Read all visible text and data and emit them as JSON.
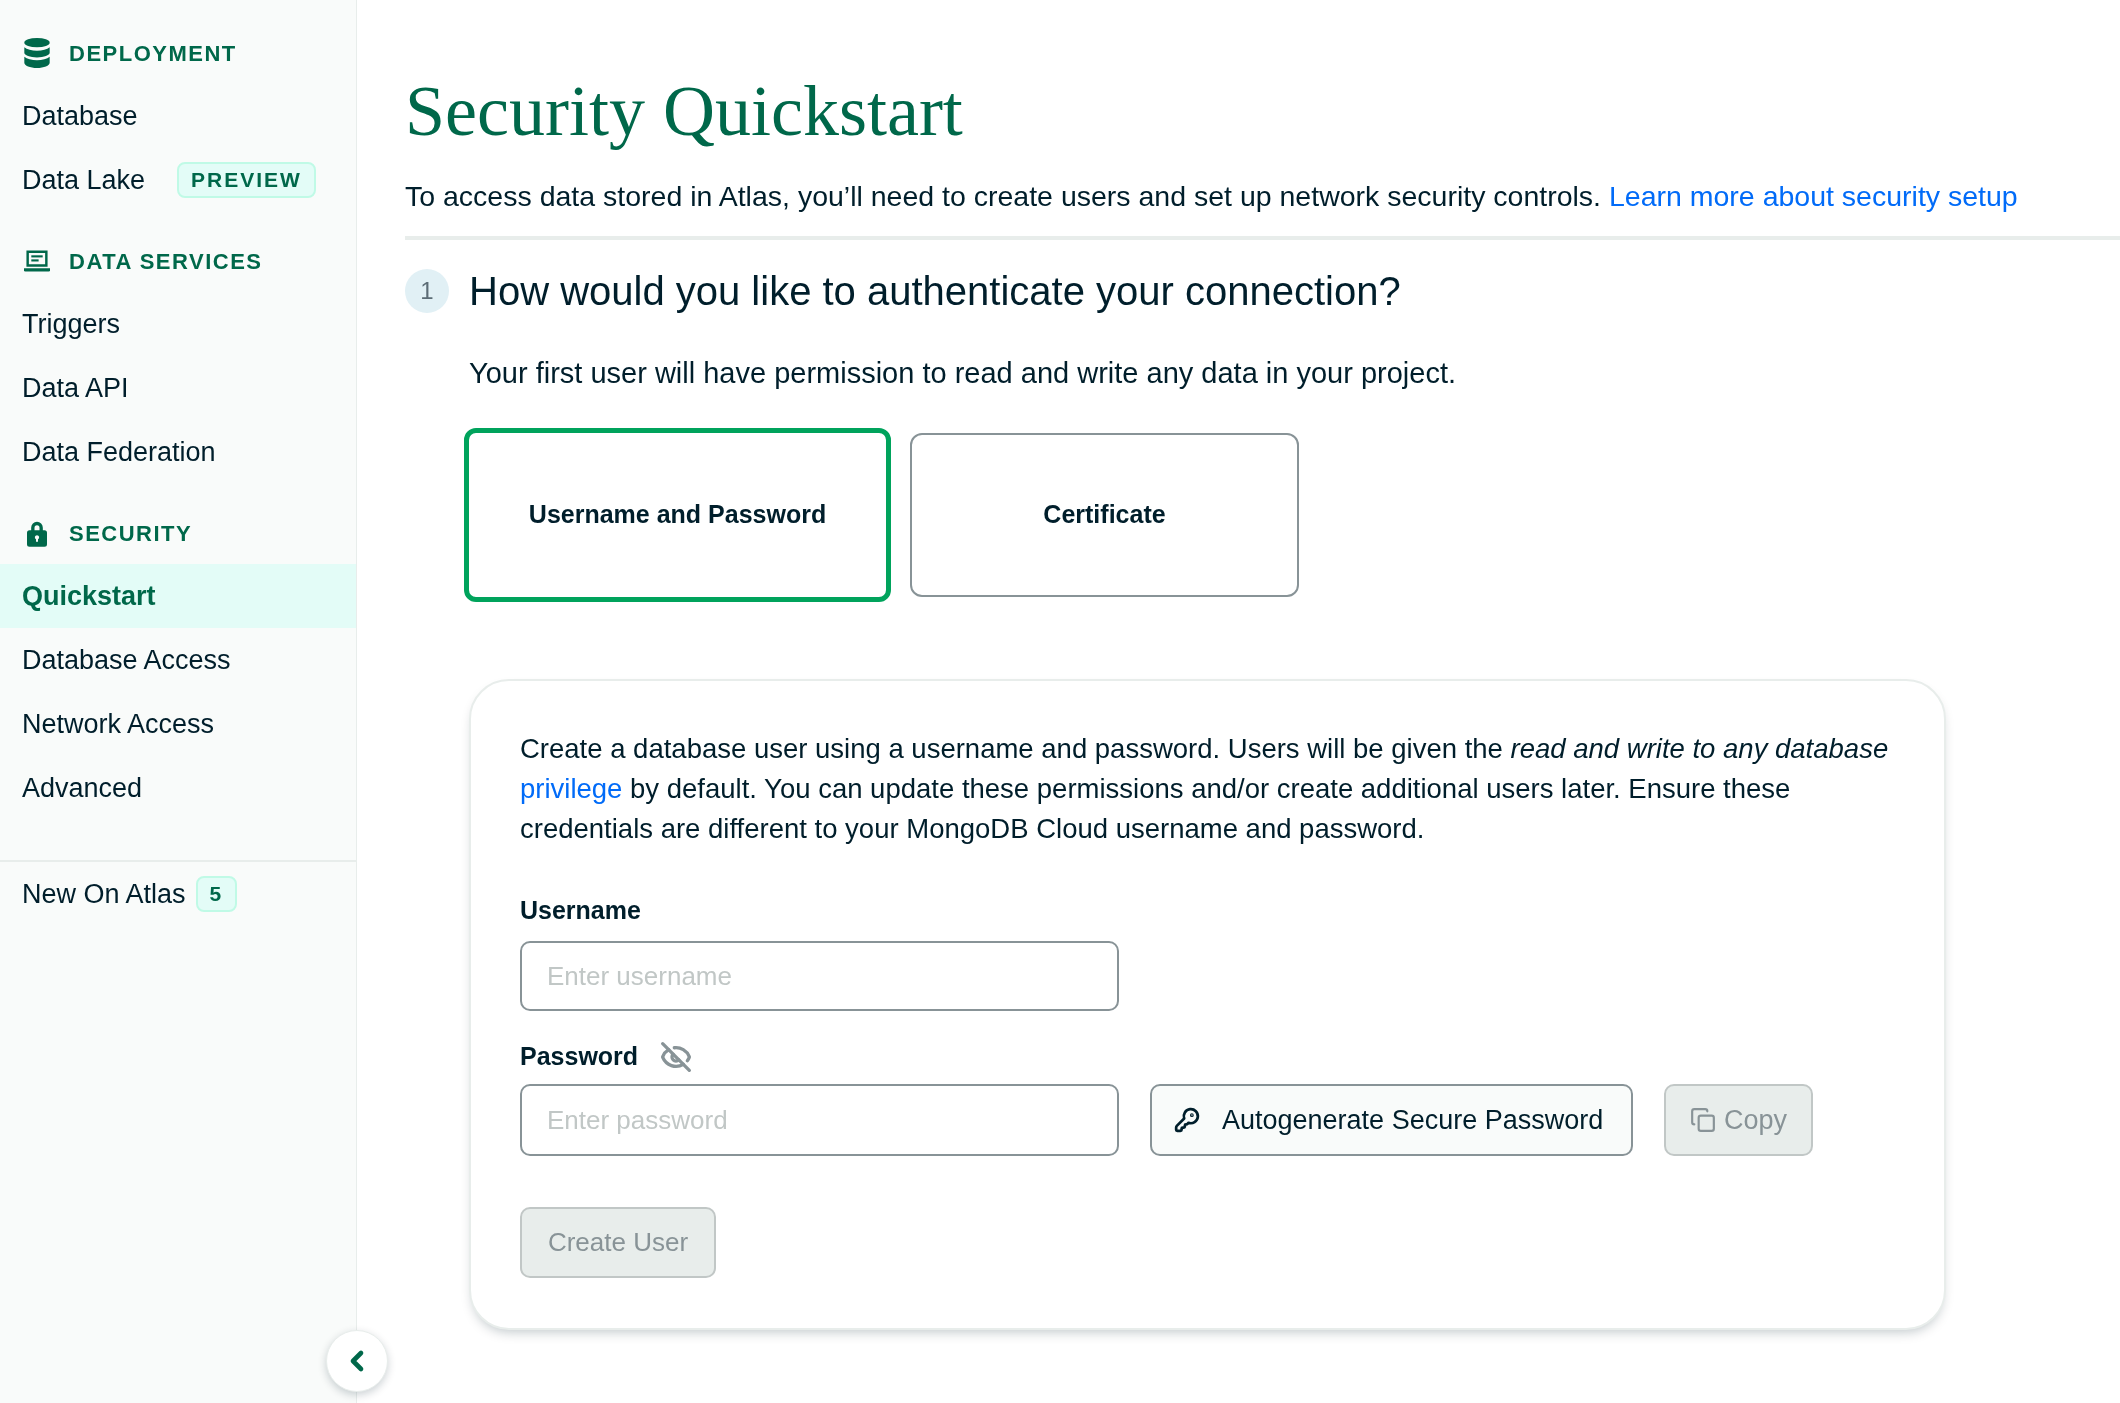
{
  "sidebar": {
    "sections": [
      {
        "title": "DEPLOYMENT",
        "items": [
          {
            "label": "Database",
            "selected": false
          },
          {
            "label": "Data Lake",
            "selected": false,
            "badge": "PREVIEW"
          }
        ]
      },
      {
        "title": "DATA SERVICES",
        "items": [
          {
            "label": "Triggers",
            "selected": false
          },
          {
            "label": "Data API",
            "selected": false
          },
          {
            "label": "Data Federation",
            "selected": false
          }
        ]
      },
      {
        "title": "SECURITY",
        "items": [
          {
            "label": "Quickstart",
            "selected": true
          },
          {
            "label": "Database Access",
            "selected": false
          },
          {
            "label": "Network Access",
            "selected": false
          },
          {
            "label": "Advanced",
            "selected": false
          }
        ]
      }
    ],
    "footer_items": [
      {
        "label": "New On Atlas",
        "selected": false,
        "badge": "5"
      }
    ]
  },
  "header": {
    "title": "Security Quickstart",
    "intro": "To access data stored in Atlas, you’ll need to create users and set up network security controls.",
    "link": "Learn more about security setup"
  },
  "step": {
    "number": "1",
    "heading": "How would you like to authenticate your connection?",
    "subtitle": "Your first user will have permission to read and write any data in your project."
  },
  "auth_options": [
    {
      "label": "Username and Password",
      "selected": true
    },
    {
      "label": "Certificate",
      "selected": false
    }
  ],
  "user_form": {
    "description_start": "Create a database user using a username and password. Users will be given the *read and write to any database*",
    "description_link": "privilege",
    "description_end": "by default. You can update these permissions and/or create additional users later. Ensure these credentials are different to your MongoDB Cloud username and password.",
    "username": {
      "label": "Username",
      "placeholder": "Enter username"
    },
    "password": {
      "label": "Password",
      "placeholder": "Enter password",
      "visible": false
    },
    "autogenerate_button": {
      "label": "Autogenerate Secure Password"
    },
    "copy_button": {
      "label": "Copy",
      "disabled": true
    },
    "create_button": {
      "label": "Create User",
      "disabled": true
    }
  }
}
